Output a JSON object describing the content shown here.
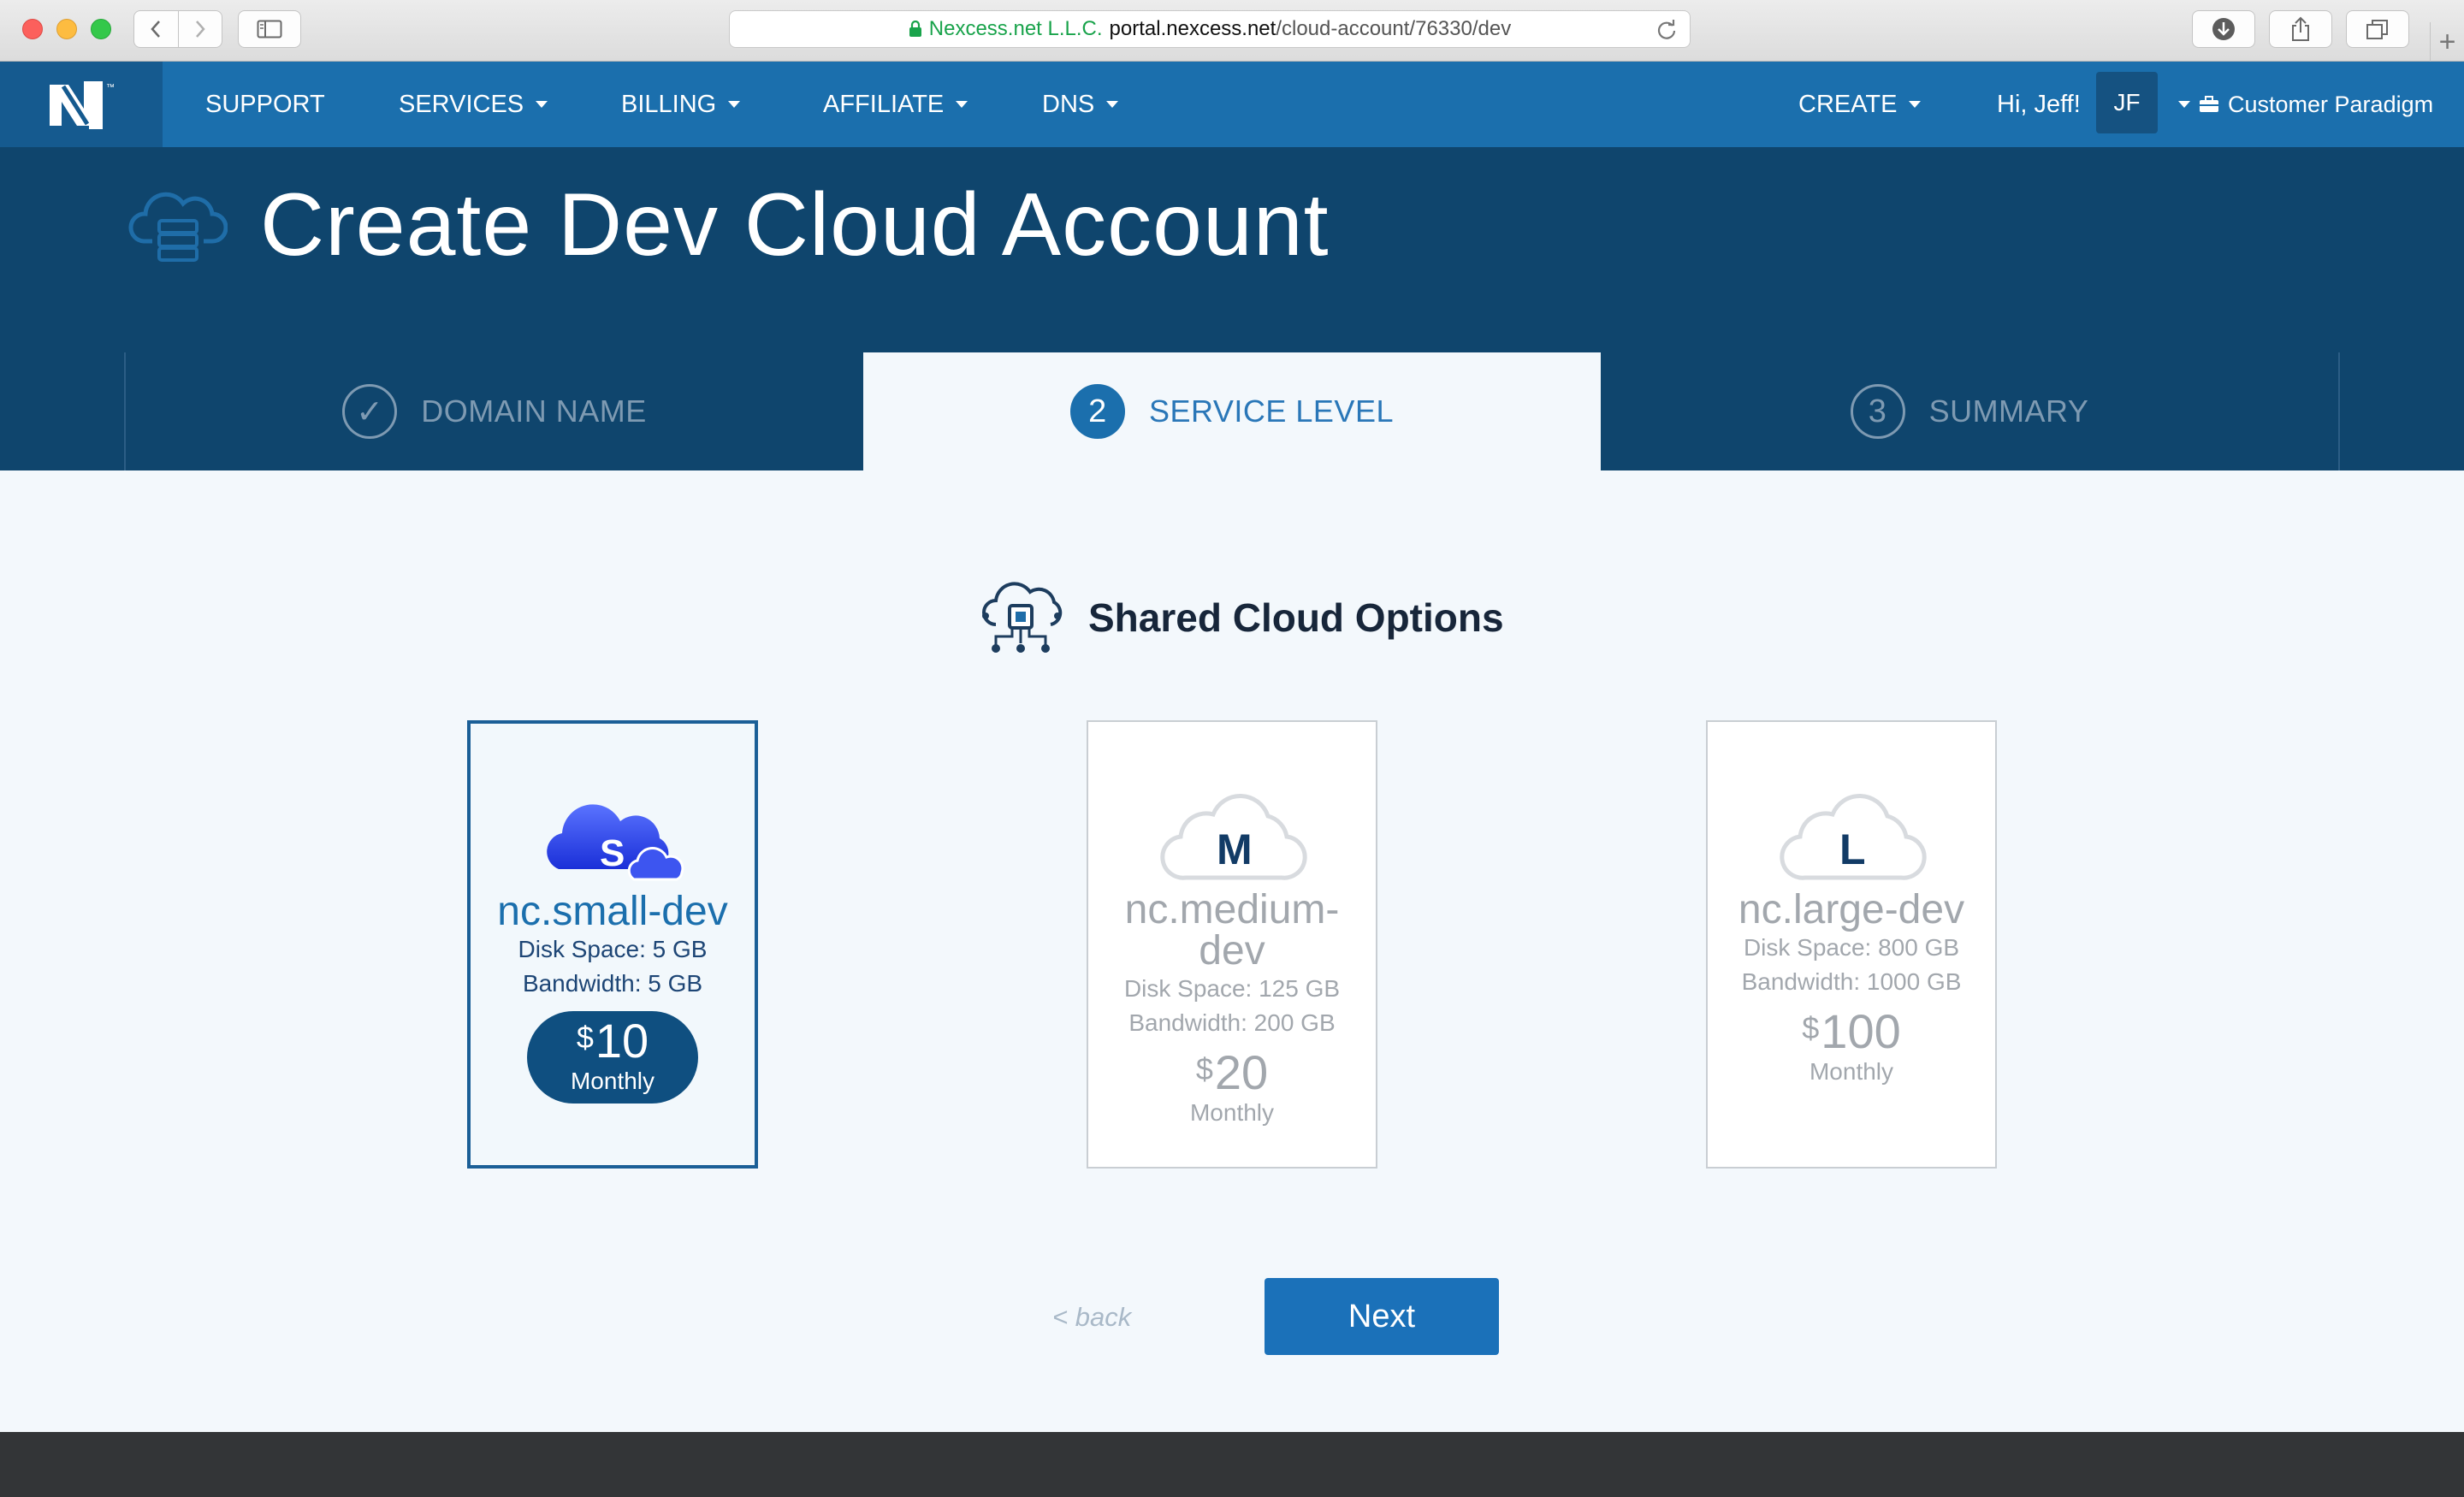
{
  "browser": {
    "url_org": "Nexcess.net L.L.C.",
    "url_host": "portal.nexcess.net",
    "url_path": "/cloud-account/76330/dev",
    "new_tab_symbol": "+"
  },
  "nav": {
    "items": [
      {
        "label": "SUPPORT",
        "dropdown": false
      },
      {
        "label": "SERVICES",
        "dropdown": true
      },
      {
        "label": "BILLING",
        "dropdown": true
      },
      {
        "label": "AFFILIATE",
        "dropdown": true
      },
      {
        "label": "DNS",
        "dropdown": true
      }
    ],
    "create_label": "CREATE",
    "greeting": "Hi, Jeff!",
    "avatar_initials": "JF",
    "account_name": "Customer Paradigm",
    "colors": {
      "nav_bg": "#1b6fad",
      "logo_bg": "#155a8f",
      "banner_bg": "#0f456d"
    }
  },
  "header": {
    "title": "Create Dev Cloud Account"
  },
  "steps": [
    {
      "number": "✓",
      "label": "DOMAIN NAME",
      "state": "done"
    },
    {
      "number": "2",
      "label": "SERVICE LEVEL",
      "state": "active"
    },
    {
      "number": "3",
      "label": "SUMMARY",
      "state": "pending"
    }
  ],
  "section": {
    "title": "Shared Cloud Options"
  },
  "plans": [
    {
      "letter": "S",
      "name": "nc.small-dev",
      "disk": "Disk Space: 5 GB",
      "bandwidth": "Bandwidth: 5 GB",
      "currency": "$",
      "price": "10",
      "period": "Monthly",
      "selected": true
    },
    {
      "letter": "M",
      "name": "nc.medium-dev",
      "disk": "Disk Space: 125 GB",
      "bandwidth": "Bandwidth: 200 GB",
      "currency": "$",
      "price": "20",
      "period": "Monthly",
      "selected": false
    },
    {
      "letter": "L",
      "name": "nc.large-dev",
      "disk": "Disk Space: 800 GB",
      "bandwidth": "Bandwidth: 1000 GB",
      "currency": "$",
      "price": "100",
      "period": "Monthly",
      "selected": false
    }
  ],
  "actions": {
    "back_label": "< back",
    "next_label": "Next"
  }
}
